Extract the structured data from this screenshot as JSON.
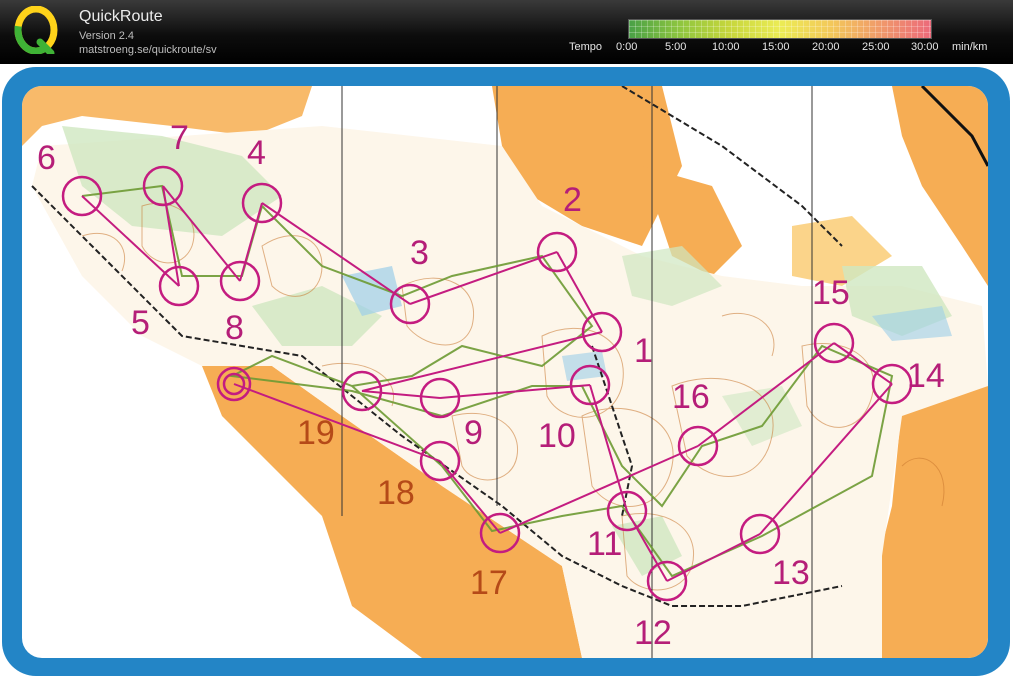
{
  "app": {
    "title": "QuickRoute",
    "version": "Version 2.4",
    "url": "matstroeng.se/quickroute/sv"
  },
  "tempo": {
    "label": "Tempo",
    "ticks": [
      "0:00",
      "5:00",
      "10:00",
      "15:00",
      "20:00",
      "25:00",
      "30:00"
    ],
    "unit": "min/km"
  },
  "map": {
    "controls": [
      {
        "label": "1"
      },
      {
        "label": "2"
      },
      {
        "label": "3"
      },
      {
        "label": "4"
      },
      {
        "label": "5"
      },
      {
        "label": "6"
      },
      {
        "label": "7"
      },
      {
        "label": "8"
      },
      {
        "label": "9"
      },
      {
        "label": "10"
      },
      {
        "label": "11"
      },
      {
        "label": "12"
      },
      {
        "label": "13"
      },
      {
        "label": "14"
      },
      {
        "label": "15"
      },
      {
        "label": "16"
      },
      {
        "label": "17"
      },
      {
        "label": "18"
      },
      {
        "label": "19"
      }
    ]
  }
}
